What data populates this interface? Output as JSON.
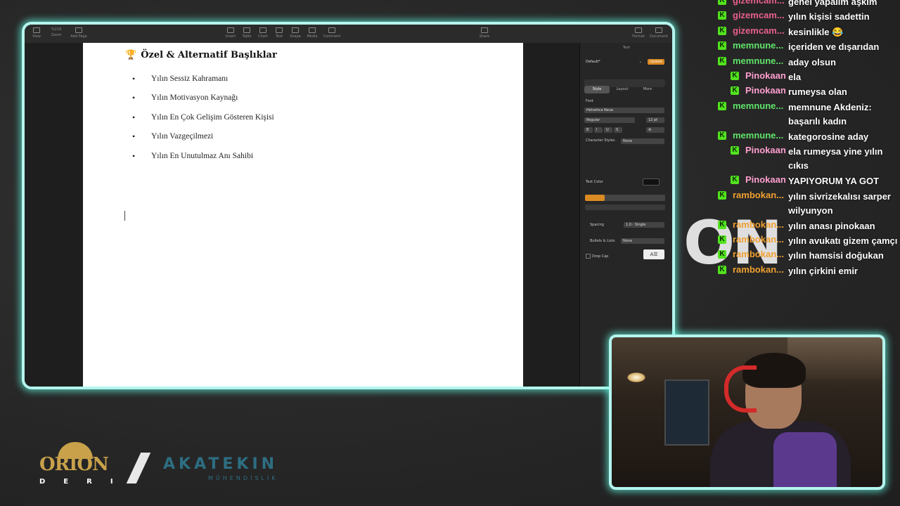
{
  "toolbar": {
    "left": [
      {
        "label": "View",
        "icon": "sidebar-icon"
      },
      {
        "label": "Zoom",
        "value": "%219",
        "icon": "zoom-icon"
      },
      {
        "label": "Add Page",
        "icon": "add-page-icon"
      }
    ],
    "center": [
      {
        "label": "Insert",
        "icon": "insert-icon"
      },
      {
        "label": "Table",
        "icon": "table-icon"
      },
      {
        "label": "Chart",
        "icon": "chart-icon"
      },
      {
        "label": "Text",
        "icon": "text-icon"
      },
      {
        "label": "Shape",
        "icon": "shape-icon"
      },
      {
        "label": "Media",
        "icon": "media-icon"
      },
      {
        "label": "Comment",
        "icon": "comment-icon"
      }
    ],
    "share": {
      "label": "Share",
      "icon": "share-icon"
    },
    "right": [
      {
        "label": "Format",
        "icon": "format-icon"
      },
      {
        "label": "Document",
        "icon": "document-icon"
      }
    ]
  },
  "document": {
    "heading": "Özel & Alternatif Başlıklar",
    "heading_icon": "trophy-icon",
    "items": [
      "Yılın Sessiz Kahramanı",
      "Yılın Motivasyon Kaynağı",
      "Yılın En Çok Gelişim Gösteren Kişisi",
      "Yılın Vazgeçilmezi",
      "Yılın En Unutulmaz Anı Sahibi"
    ]
  },
  "inspector": {
    "title": "Text",
    "paragraph_style": "Default*",
    "update_label": "Update",
    "tabs": [
      "Style",
      "Layout",
      "More"
    ],
    "font_label": "Font",
    "font_family": "Helvetica Neue",
    "font_weight": "Regular",
    "font_size": "12 pt",
    "format_buttons": [
      "B",
      "I",
      "U",
      "S"
    ],
    "character_styles_label": "Character Styles",
    "character_styles_value": "None",
    "text_color_label": "Text Color",
    "spacing_label": "Spacing",
    "spacing_value": "1.0 - Single",
    "bullets_label": "Bullets & Lists",
    "bullets_value": "None",
    "drop_cap_label": "Drop Cap"
  },
  "chat": [
    {
      "user": "gizemcam...",
      "color": "#e8608a",
      "message": "genel yapalım aşkım"
    },
    {
      "user": "gizemcam...",
      "color": "#e8608a",
      "message": "yılın kişisi sadettin"
    },
    {
      "user": "gizemcam...",
      "color": "#e8608a",
      "message": "kesinlikle 😂"
    },
    {
      "user": "memnune...",
      "color": "#5fe36a",
      "message": "içeriden ve dışarıdan"
    },
    {
      "user": "memnune...",
      "color": "#5fe36a",
      "message": "aday olsun"
    },
    {
      "user": "Pinokaan",
      "color": "#ff9fd0",
      "message": "ela",
      "indent": true
    },
    {
      "user": "Pinokaan",
      "color": "#ff9fd0",
      "message": "rumeysa olan",
      "indent": true
    },
    {
      "user": "memnune...",
      "color": "#5fe36a",
      "message": "memnune Akdeniz: başarılı kadın",
      "tall": true
    },
    {
      "user": "memnune...",
      "color": "#5fe36a",
      "message": "kategorosine aday"
    },
    {
      "user": "Pinokaan",
      "color": "#ff9fd0",
      "message": "ela rumeysa yine yılın cıkıs",
      "indent": true,
      "tall": true
    },
    {
      "user": "Pinokaan",
      "color": "#ff9fd0",
      "message": "YAPIYORUM YA GOT",
      "indent": true
    },
    {
      "user": "rambokan...",
      "color": "#f0a030",
      "message": "yılın sivrizekalısı sarper wilyunyon",
      "tall": true
    },
    {
      "user": "rambokan...",
      "color": "#f0a030",
      "message": "yılın anası pinokaan"
    },
    {
      "user": "rambokan...",
      "color": "#f0a030",
      "message": "yılın avukatı gizem çamçı"
    },
    {
      "user": "rambokan...",
      "color": "#f0a030",
      "message": "yılın hamsisi doğukan"
    },
    {
      "user": "rambokan...",
      "color": "#f0a030",
      "message": "yılın çirkini emir"
    }
  ],
  "overlay_text": "ON",
  "sponsors": {
    "orion_name": "ORION",
    "orion_sub": "DERI",
    "akatekin_name": "AKATEKIN",
    "akatekin_sub": "MÜHENDİSLİK"
  },
  "accent_color": "#b5f5ee"
}
